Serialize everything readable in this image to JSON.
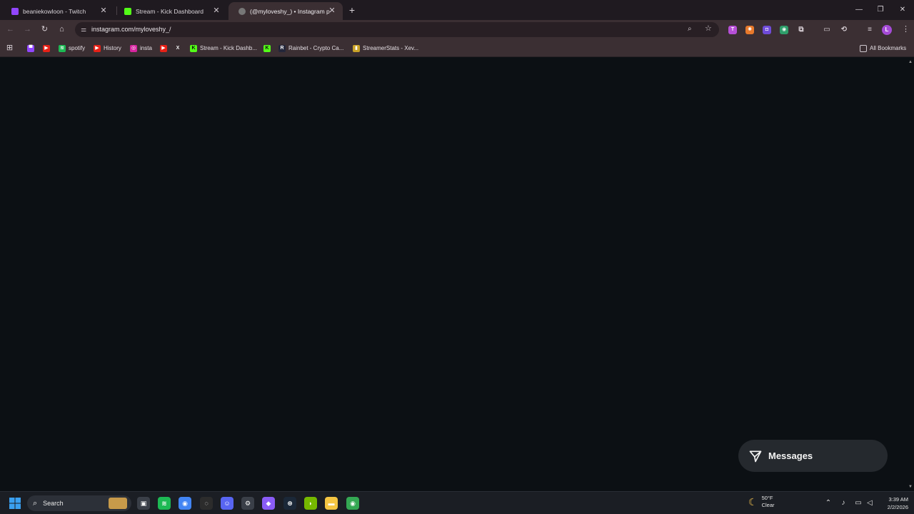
{
  "browser": {
    "tabs": [
      {
        "title": "beaniekowloon - Twitch",
        "favicon": "twitch-icon",
        "color": "#9146ff",
        "active": false
      },
      {
        "title": "Stream - Kick Dashboard",
        "favicon": "kick-icon",
        "color": "#53fc18",
        "active": false
      },
      {
        "title": "(@myloveshy_) • Instagram ph",
        "favicon": "instagram-icon",
        "color": "#777777",
        "active": true
      }
    ],
    "new_tab_glyph": "+",
    "window_controls": {
      "minimize": "—",
      "restore": "❐",
      "close": "✕"
    }
  },
  "toolbar": {
    "back": "←",
    "forward": "→",
    "reload": "↻",
    "home": "⌂",
    "url": "instagram.com/myloveshy_/",
    "profile_initial": "L",
    "extensions": [
      {
        "name": "extension-twitch-icon",
        "color": "#b64fd6",
        "glyph": "T"
      },
      {
        "name": "extension-orange-icon",
        "color": "#e8792b",
        "glyph": "✺"
      },
      {
        "name": "extension-purple-icon",
        "color": "#6f4bd8",
        "glyph": "◘"
      },
      {
        "name": "extension-green-icon",
        "color": "#2e9e6a",
        "glyph": "◉"
      },
      {
        "name": "extensions-puzzle-icon",
        "color": "transparent",
        "glyph": "⧉"
      },
      {
        "name": "cast-icon",
        "color": "transparent",
        "glyph": "▭"
      },
      {
        "name": "tab-search-icon",
        "color": "transparent",
        "glyph": "⟲"
      },
      {
        "name": "reading-list-icon",
        "color": "transparent",
        "glyph": "≡"
      }
    ],
    "menu_glyph": "⋮"
  },
  "bookmarks": {
    "apps_glyph": "⊞",
    "items": [
      {
        "label": "",
        "icon": "twitch-icon",
        "color": "#9146ff",
        "glyph": "▀"
      },
      {
        "label": "",
        "icon": "youtube-icon",
        "color": "#e62117",
        "glyph": "▶"
      },
      {
        "label": "spotify",
        "icon": "spotify-icon",
        "color": "#1db954",
        "glyph": "≋"
      },
      {
        "label": "History",
        "icon": "youtube-icon",
        "color": "#e62117",
        "glyph": "▶"
      },
      {
        "label": "insta",
        "icon": "instagram-icon",
        "color": "#d6249f",
        "glyph": "◎"
      },
      {
        "label": "",
        "icon": "youtube-icon",
        "color": "#e62117",
        "glyph": "▶"
      },
      {
        "label": "",
        "icon": "x-icon",
        "color": "#000000",
        "glyph": "X"
      },
      {
        "label": "Stream - Kick Dashb...",
        "icon": "kick-icon",
        "color": "#53fc18",
        "glyph": "K"
      },
      {
        "label": "",
        "icon": "kick-icon",
        "color": "#53fc18",
        "glyph": "K"
      },
      {
        "label": "Rainbet - Crypto Ca...",
        "icon": "rainbet-icon",
        "color": "#23263a",
        "glyph": "R"
      },
      {
        "label": "StreamerStats - Xev...",
        "icon": "chart-icon",
        "color": "#c9a227",
        "glyph": "▮"
      }
    ],
    "all_bookmarks": "All Bookmarks"
  },
  "page": {
    "background": "#0c1014",
    "messages_label": "Messages"
  },
  "taskbar": {
    "search_label": "Search",
    "apps": [
      {
        "name": "file-explorer-task-view-icon",
        "color": "#3a3f48",
        "glyph": "▣"
      },
      {
        "name": "spotify-taskbar-icon",
        "color": "#1db954",
        "glyph": "≋"
      },
      {
        "name": "chrome-taskbar-icon",
        "color": "#4285f4",
        "glyph": "◉"
      },
      {
        "name": "obs-taskbar-icon",
        "color": "#2c2c2c",
        "glyph": "◌"
      },
      {
        "name": "discord-taskbar-icon",
        "color": "#5865f2",
        "glyph": "☺"
      },
      {
        "name": "settings-taskbar-icon",
        "color": "#3a3f48",
        "glyph": "⚙"
      },
      {
        "name": "game-taskbar-icon",
        "color": "#8a5cf6",
        "glyph": "◆"
      },
      {
        "name": "steam-taskbar-icon",
        "color": "#1b2838",
        "glyph": "⊛"
      },
      {
        "name": "nvidia-taskbar-icon",
        "color": "#76b900",
        "glyph": "◗"
      },
      {
        "name": "folder-taskbar-icon",
        "color": "#f4c542",
        "glyph": "▬"
      },
      {
        "name": "chrome-profile-taskbar-icon",
        "color": "#34a853",
        "glyph": "◉"
      }
    ],
    "weather": {
      "temp": "50°F",
      "condition": "Clear"
    },
    "clock": {
      "time": "3:39 AM",
      "date": "2/2/2026"
    }
  }
}
